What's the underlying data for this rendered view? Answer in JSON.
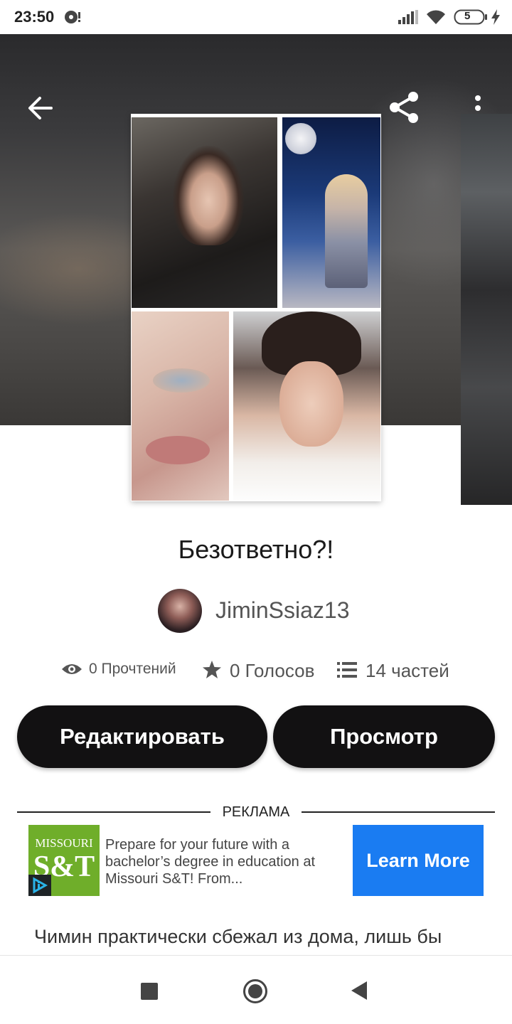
{
  "status_bar": {
    "time": "23:50",
    "battery": "5",
    "icons": [
      "sync-icon",
      "signal-icon",
      "wifi-icon",
      "battery-icon",
      "charging-icon"
    ]
  },
  "top_bar": {
    "icons": [
      "back-arrow-icon",
      "share-icon",
      "more-vert-icon"
    ]
  },
  "story": {
    "title": "Безответно?!",
    "author": "JiminSsiaz13",
    "stats": {
      "reads": "0 Прочтений",
      "votes": "0 Голосов",
      "parts": "14 частей"
    },
    "excerpt": "Чимин практически сбежал из дома, лишь бы"
  },
  "actions": {
    "edit_label": "Редактировать",
    "view_label": "Просмотр"
  },
  "ad": {
    "label": "РЕКЛАМА",
    "logo_line1": "MISSOURI",
    "logo_line2": "S&T",
    "text": "Prepare for your future with a bachelor’s degree in education at Missouri S&T! From...",
    "cta": "Learn More"
  },
  "colors": {
    "button_bg": "#121112",
    "cta_blue": "#1a7cf2",
    "logo_green": "#6fae2a"
  }
}
